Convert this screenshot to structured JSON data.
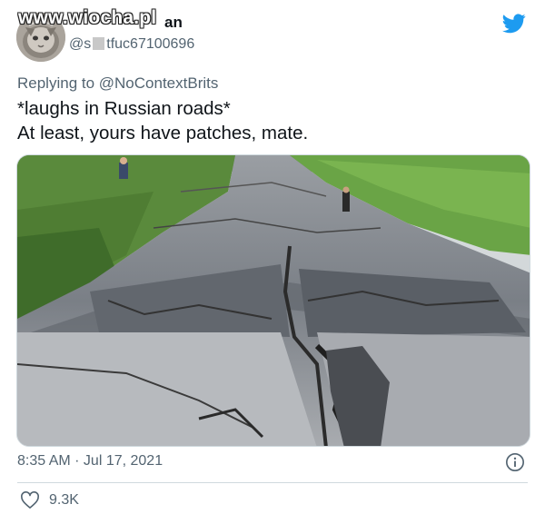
{
  "watermark": "www.wiocha.pl",
  "author": {
    "display_name_visible": "an",
    "handle_prefix": "@s",
    "handle_suffix": "tfuc67100696"
  },
  "reply_to": "Replying to @NoContextBrits",
  "tweet": {
    "line1": "*laughs in Russian roads*",
    "line2": "At least, yours have patches, mate."
  },
  "timestamp": "8:35 AM · Jul 17, 2021",
  "likes": "9.3K",
  "icons": {
    "brand": "twitter-bird-icon",
    "info": "info-icon",
    "like": "heart-icon"
  },
  "colors": {
    "twitter_blue": "#1d9bf0",
    "secondary_text": "#536471",
    "primary_text": "#0f1419",
    "divider": "#cfd9de"
  }
}
